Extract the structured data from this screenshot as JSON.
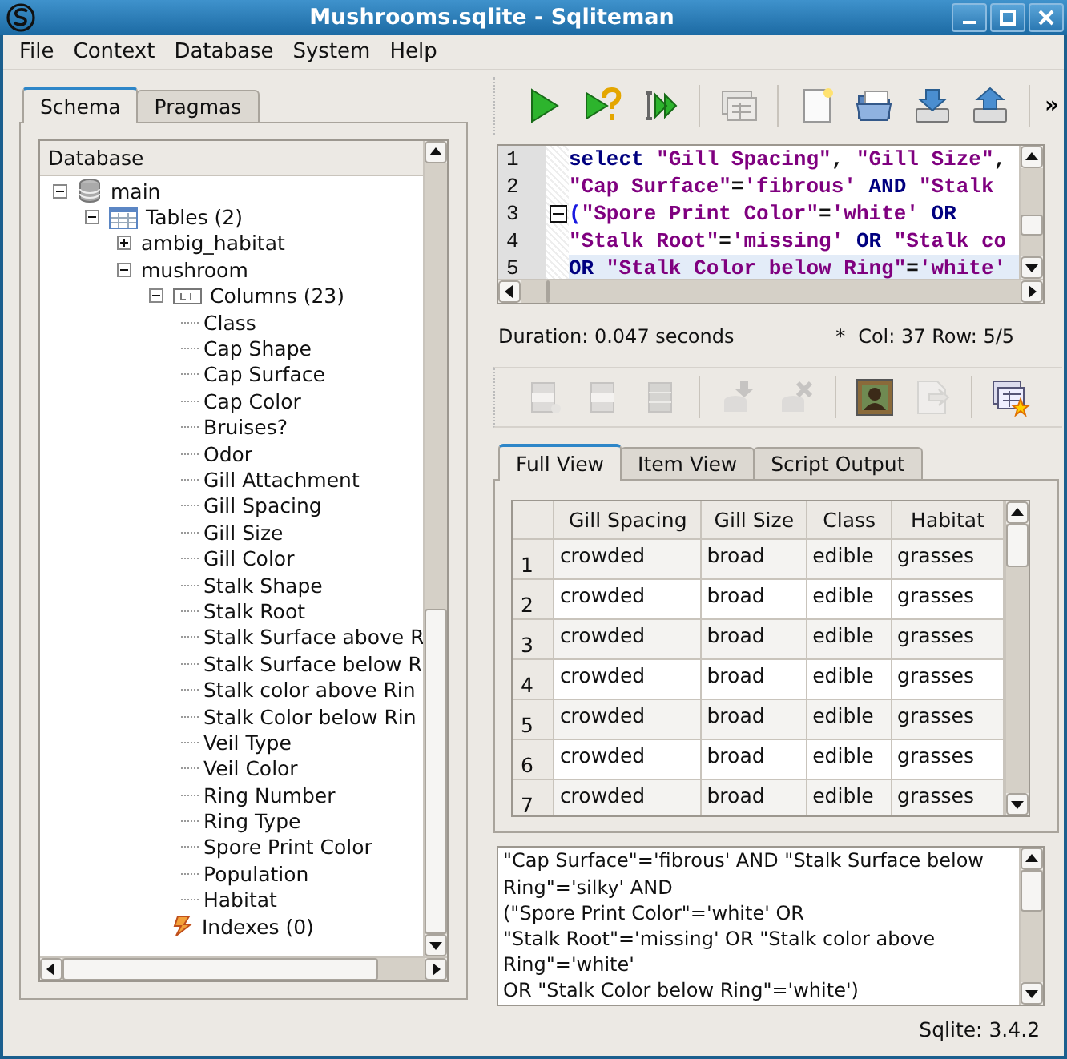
{
  "window": {
    "title": "Mushrooms.sqlite - Sqliteman"
  },
  "menu": [
    "File",
    "Context",
    "Database",
    "System",
    "Help"
  ],
  "schema_tabs": [
    {
      "label": "Schema",
      "selected": true
    },
    {
      "label": "Pragmas",
      "selected": false
    }
  ],
  "tree": {
    "header": "Database",
    "nodes": [
      {
        "label": "main",
        "kind": "database",
        "expanded": true,
        "children": [
          {
            "label": "Tables (2)",
            "kind": "tables",
            "expanded": true,
            "children": [
              {
                "label": "ambig_habitat",
                "expanded": false
              },
              {
                "label": "mushroom",
                "expanded": true,
                "children": [
                  {
                    "label": "Columns (23)",
                    "kind": "columns",
                    "expanded": true,
                    "children": [
                      {
                        "label": "Class",
                        "kind": "column"
                      },
                      {
                        "label": "Cap Shape",
                        "kind": "column"
                      },
                      {
                        "label": "Cap Surface",
                        "kind": "column"
                      },
                      {
                        "label": "Cap Color",
                        "kind": "column"
                      },
                      {
                        "label": "Bruises?",
                        "kind": "column"
                      },
                      {
                        "label": "Odor",
                        "kind": "column"
                      },
                      {
                        "label": "Gill Attachment",
                        "kind": "column"
                      },
                      {
                        "label": "Gill Spacing",
                        "kind": "column"
                      },
                      {
                        "label": "Gill Size",
                        "kind": "column"
                      },
                      {
                        "label": "Gill Color",
                        "kind": "column"
                      },
                      {
                        "label": "Stalk Shape",
                        "kind": "column"
                      },
                      {
                        "label": "Stalk Root",
                        "kind": "column"
                      },
                      {
                        "label": "Stalk Surface above R",
                        "kind": "column"
                      },
                      {
                        "label": "Stalk Surface below R",
                        "kind": "column"
                      },
                      {
                        "label": "Stalk color above Rin",
                        "kind": "column"
                      },
                      {
                        "label": "Stalk Color below Rin",
                        "kind": "column"
                      },
                      {
                        "label": "Veil Type",
                        "kind": "column"
                      },
                      {
                        "label": "Veil Color",
                        "kind": "column"
                      },
                      {
                        "label": "Ring Number",
                        "kind": "column"
                      },
                      {
                        "label": "Ring Type",
                        "kind": "column"
                      },
                      {
                        "label": "Spore Print Color",
                        "kind": "column"
                      },
                      {
                        "label": "Population",
                        "kind": "column"
                      },
                      {
                        "label": "Habitat",
                        "kind": "column"
                      }
                    ]
                  },
                  {
                    "label": "Indexes (0)",
                    "kind": "indexes"
                  }
                ]
              }
            ]
          }
        ]
      }
    ]
  },
  "main_toolbar": {
    "buttons": [
      {
        "kind": "run",
        "disabled": false
      },
      {
        "kind": "explain",
        "disabled": false
      },
      {
        "kind": "run-script",
        "disabled": false
      },
      {
        "kind": "separator"
      },
      {
        "kind": "window",
        "disabled": true
      },
      {
        "kind": "separator"
      },
      {
        "kind": "new-file",
        "disabled": false
      },
      {
        "kind": "open-folder",
        "disabled": false
      },
      {
        "kind": "drive-down",
        "disabled": false
      },
      {
        "kind": "drive-up",
        "disabled": false
      },
      {
        "kind": "separator"
      }
    ],
    "overflow": "»"
  },
  "editor": {
    "lines": [
      {
        "number": "1",
        "current": false,
        "fold": false,
        "tokens": [
          {
            "kind": "keyword",
            "text": "select "
          },
          {
            "kind": "string",
            "text": "\"Gill Spacing\""
          },
          {
            "kind": "plain",
            "text": ", "
          },
          {
            "kind": "string",
            "text": "\"Gill Size\""
          },
          {
            "kind": "plain",
            "text": ","
          }
        ]
      },
      {
        "number": "2",
        "current": false,
        "fold": false,
        "tokens": [
          {
            "kind": "string",
            "text": "\"Cap Surface\""
          },
          {
            "kind": "plain",
            "text": "="
          },
          {
            "kind": "string",
            "text": "'fibrous'"
          },
          {
            "kind": "keyword",
            "text": " AND "
          },
          {
            "kind": "string",
            "text": "\"Stalk"
          }
        ]
      },
      {
        "number": "3",
        "current": false,
        "fold": true,
        "tokens": [
          {
            "kind": "paren",
            "text": "("
          },
          {
            "kind": "string",
            "text": "\"Spore Print Color\""
          },
          {
            "kind": "plain",
            "text": "="
          },
          {
            "kind": "string",
            "text": "'white'"
          },
          {
            "kind": "keyword",
            "text": " OR"
          }
        ]
      },
      {
        "number": "4",
        "current": false,
        "fold": false,
        "tokens": [
          {
            "kind": "string",
            "text": "\"Stalk Root\""
          },
          {
            "kind": "plain",
            "text": "="
          },
          {
            "kind": "string",
            "text": "'missing'"
          },
          {
            "kind": "keyword",
            "text": " OR "
          },
          {
            "kind": "string",
            "text": "\"Stalk co"
          }
        ]
      },
      {
        "number": "5",
        "current": true,
        "fold": false,
        "tokens": [
          {
            "kind": "keyword",
            "text": "OR "
          },
          {
            "kind": "string",
            "text": "\"Stalk Color below Ring\""
          },
          {
            "kind": "plain",
            "text": "="
          },
          {
            "kind": "string",
            "text": "'white'"
          }
        ]
      }
    ]
  },
  "query_status": {
    "duration": "Duration: 0.047 seconds",
    "modified": "*",
    "cursor": "Col: 37 Row: 5/5"
  },
  "data_toolbar": {
    "buttons": [
      {
        "kind": "row-add",
        "disabled": true
      },
      {
        "kind": "row",
        "disabled": true
      },
      {
        "kind": "rows",
        "disabled": true
      },
      {
        "kind": "separator"
      },
      {
        "kind": "db-down",
        "disabled": true
      },
      {
        "kind": "db-delete",
        "disabled": true
      },
      {
        "kind": "separator"
      },
      {
        "kind": "picture",
        "disabled": false
      },
      {
        "kind": "doc-export",
        "disabled": true
      },
      {
        "kind": "separator"
      },
      {
        "kind": "new-table",
        "disabled": false
      }
    ]
  },
  "result_tabs": [
    {
      "label": "Full View",
      "selected": true
    },
    {
      "label": "Item View",
      "selected": false
    },
    {
      "label": "Script Output",
      "selected": false
    }
  ],
  "table": {
    "columns": [
      "Gill Spacing",
      "Gill Size",
      "Class",
      "Habitat"
    ],
    "rows": [
      {
        "number": "1",
        "cells": [
          "crowded",
          "broad",
          "edible",
          "grasses"
        ]
      },
      {
        "number": "2",
        "cells": [
          "crowded",
          "broad",
          "edible",
          "grasses"
        ]
      },
      {
        "number": "3",
        "cells": [
          "crowded",
          "broad",
          "edible",
          "grasses"
        ]
      },
      {
        "number": "4",
        "cells": [
          "crowded",
          "broad",
          "edible",
          "grasses"
        ]
      },
      {
        "number": "5",
        "cells": [
          "crowded",
          "broad",
          "edible",
          "grasses"
        ]
      },
      {
        "number": "6",
        "cells": [
          "crowded",
          "broad",
          "edible",
          "grasses"
        ]
      },
      {
        "number": "7",
        "cells": [
          "crowded",
          "broad",
          "edible",
          "grasses"
        ]
      }
    ]
  },
  "output": [
    "\"Cap Surface\"='fibrous' AND \"Stalk Surface below",
    "Ring\"='silky' AND",
    "(\"Spore Print Color\"='white' OR",
    "\"Stalk Root\"='missing' OR \"Stalk color above",
    "Ring\"='white'",
    "OR \"Stalk Color below Ring\"='white')"
  ],
  "status_bar": "Sqlite: 3.4.2"
}
